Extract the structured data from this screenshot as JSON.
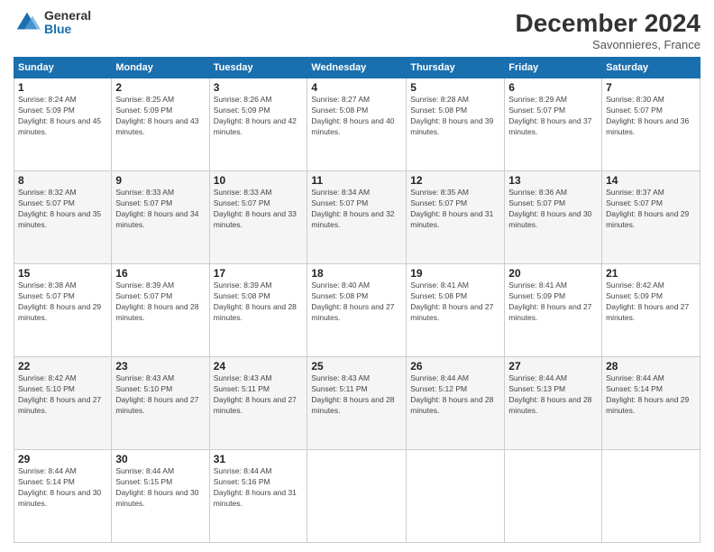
{
  "header": {
    "logo_general": "General",
    "logo_blue": "Blue",
    "main_title": "December 2024",
    "subtitle": "Savonnieres, France"
  },
  "calendar": {
    "days_of_week": [
      "Sunday",
      "Monday",
      "Tuesday",
      "Wednesday",
      "Thursday",
      "Friday",
      "Saturday"
    ],
    "weeks": [
      [
        null,
        {
          "day": 2,
          "sunrise": "8:25 AM",
          "sunset": "5:09 PM",
          "daylight": "8 hours and 43 minutes."
        },
        {
          "day": 3,
          "sunrise": "8:26 AM",
          "sunset": "5:09 PM",
          "daylight": "8 hours and 42 minutes."
        },
        {
          "day": 4,
          "sunrise": "8:27 AM",
          "sunset": "5:08 PM",
          "daylight": "8 hours and 40 minutes."
        },
        {
          "day": 5,
          "sunrise": "8:28 AM",
          "sunset": "5:08 PM",
          "daylight": "8 hours and 39 minutes."
        },
        {
          "day": 6,
          "sunrise": "8:29 AM",
          "sunset": "5:07 PM",
          "daylight": "8 hours and 37 minutes."
        },
        {
          "day": 7,
          "sunrise": "8:30 AM",
          "sunset": "5:07 PM",
          "daylight": "8 hours and 36 minutes."
        }
      ],
      [
        {
          "day": 1,
          "sunrise": "8:24 AM",
          "sunset": "5:09 PM",
          "daylight": "8 hours and 45 minutes."
        },
        {
          "day": 8,
          "sunrise": "8:32 AM",
          "sunset": "5:07 PM",
          "daylight": "8 hours and 35 minutes."
        },
        {
          "day": 9,
          "sunrise": "8:33 AM",
          "sunset": "5:07 PM",
          "daylight": "8 hours and 34 minutes."
        },
        {
          "day": 10,
          "sunrise": "8:33 AM",
          "sunset": "5:07 PM",
          "daylight": "8 hours and 33 minutes."
        },
        {
          "day": 11,
          "sunrise": "8:34 AM",
          "sunset": "5:07 PM",
          "daylight": "8 hours and 32 minutes."
        },
        {
          "day": 12,
          "sunrise": "8:35 AM",
          "sunset": "5:07 PM",
          "daylight": "8 hours and 31 minutes."
        },
        {
          "day": 13,
          "sunrise": "8:36 AM",
          "sunset": "5:07 PM",
          "daylight": "8 hours and 30 minutes."
        },
        {
          "day": 14,
          "sunrise": "8:37 AM",
          "sunset": "5:07 PM",
          "daylight": "8 hours and 29 minutes."
        }
      ],
      [
        {
          "day": 15,
          "sunrise": "8:38 AM",
          "sunset": "5:07 PM",
          "daylight": "8 hours and 29 minutes."
        },
        {
          "day": 16,
          "sunrise": "8:39 AM",
          "sunset": "5:07 PM",
          "daylight": "8 hours and 28 minutes."
        },
        {
          "day": 17,
          "sunrise": "8:39 AM",
          "sunset": "5:08 PM",
          "daylight": "8 hours and 28 minutes."
        },
        {
          "day": 18,
          "sunrise": "8:40 AM",
          "sunset": "5:08 PM",
          "daylight": "8 hours and 27 minutes."
        },
        {
          "day": 19,
          "sunrise": "8:41 AM",
          "sunset": "5:08 PM",
          "daylight": "8 hours and 27 minutes."
        },
        {
          "day": 20,
          "sunrise": "8:41 AM",
          "sunset": "5:09 PM",
          "daylight": "8 hours and 27 minutes."
        },
        {
          "day": 21,
          "sunrise": "8:42 AM",
          "sunset": "5:09 PM",
          "daylight": "8 hours and 27 minutes."
        }
      ],
      [
        {
          "day": 22,
          "sunrise": "8:42 AM",
          "sunset": "5:10 PM",
          "daylight": "8 hours and 27 minutes."
        },
        {
          "day": 23,
          "sunrise": "8:43 AM",
          "sunset": "5:10 PM",
          "daylight": "8 hours and 27 minutes."
        },
        {
          "day": 24,
          "sunrise": "8:43 AM",
          "sunset": "5:11 PM",
          "daylight": "8 hours and 27 minutes."
        },
        {
          "day": 25,
          "sunrise": "8:43 AM",
          "sunset": "5:11 PM",
          "daylight": "8 hours and 28 minutes."
        },
        {
          "day": 26,
          "sunrise": "8:44 AM",
          "sunset": "5:12 PM",
          "daylight": "8 hours and 28 minutes."
        },
        {
          "day": 27,
          "sunrise": "8:44 AM",
          "sunset": "5:13 PM",
          "daylight": "8 hours and 28 minutes."
        },
        {
          "day": 28,
          "sunrise": "8:44 AM",
          "sunset": "5:14 PM",
          "daylight": "8 hours and 29 minutes."
        }
      ],
      [
        {
          "day": 29,
          "sunrise": "8:44 AM",
          "sunset": "5:14 PM",
          "daylight": "8 hours and 30 minutes."
        },
        {
          "day": 30,
          "sunrise": "8:44 AM",
          "sunset": "5:15 PM",
          "daylight": "8 hours and 30 minutes."
        },
        {
          "day": 31,
          "sunrise": "8:44 AM",
          "sunset": "5:16 PM",
          "daylight": "8 hours and 31 minutes."
        },
        null,
        null,
        null,
        null
      ]
    ]
  }
}
